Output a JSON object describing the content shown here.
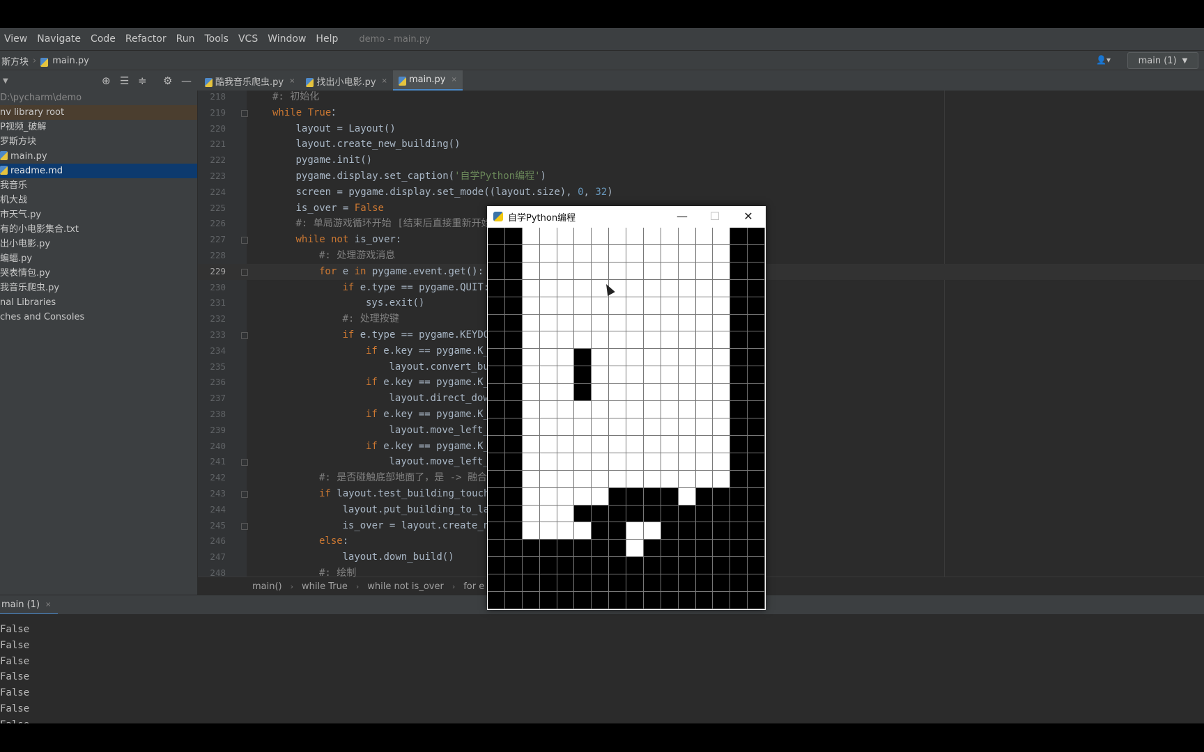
{
  "menu": {
    "items": [
      "View",
      "Navigate",
      "Code",
      "Refactor",
      "Run",
      "Tools",
      "VCS",
      "Window",
      "Help"
    ],
    "window_title": "demo - main.py"
  },
  "nav": {
    "crumb_1": "斯方块",
    "crumb_2": "main.py",
    "run_config": "main (1)"
  },
  "tabs": [
    {
      "label": "酷我音乐爬虫.py",
      "active": false
    },
    {
      "label": "找出小电影.py",
      "active": false
    },
    {
      "label": "main.py",
      "active": true
    }
  ],
  "sidebar": {
    "items": [
      {
        "label": "D:\\pycharm\\demo",
        "style": "gray"
      },
      {
        "label": "nv  library root",
        "style": "hl"
      },
      {
        "label": "P视频_破解",
        "style": ""
      },
      {
        "label": "罗斯方块",
        "style": ""
      },
      {
        "label": "main.py",
        "style": "file"
      },
      {
        "label": "readme.md",
        "style": "sel"
      },
      {
        "label": "我音乐",
        "style": ""
      },
      {
        "label": "机大战",
        "style": ""
      },
      {
        "label": "市天气.py",
        "style": ""
      },
      {
        "label": "有的小电影集合.txt",
        "style": ""
      },
      {
        "label": "出小电影.py",
        "style": ""
      },
      {
        "label": "蝙蝠.py",
        "style": ""
      },
      {
        "label": "哭表情包.py",
        "style": ""
      },
      {
        "label": "我音乐爬虫.py",
        "style": ""
      },
      {
        "label": "nal Libraries",
        "style": ""
      },
      {
        "label": "ches and Consoles",
        "style": ""
      }
    ]
  },
  "editor": {
    "current_line": 229,
    "lines": [
      {
        "n": "218",
        "indent": 0,
        "fold": false,
        "segs": [
          [
            "cm",
            "#: 初始化"
          ]
        ]
      },
      {
        "n": "219",
        "indent": 0,
        "fold": true,
        "segs": [
          [
            "kw",
            "while "
          ],
          [
            "kw",
            "True"
          ],
          [
            "",
            "："
          ]
        ]
      },
      {
        "n": "220",
        "indent": 1,
        "fold": false,
        "segs": [
          [
            "",
            "layout = Layout()"
          ]
        ]
      },
      {
        "n": "221",
        "indent": 1,
        "fold": false,
        "segs": [
          [
            "",
            "layout.create_new_building()"
          ]
        ]
      },
      {
        "n": "222",
        "indent": 1,
        "fold": false,
        "segs": [
          [
            "",
            "pygame.init()"
          ]
        ]
      },
      {
        "n": "223",
        "indent": 1,
        "fold": false,
        "segs": [
          [
            "",
            "pygame.display.set_caption("
          ],
          [
            "str",
            "'自学Python编程'"
          ],
          [
            "",
            ")"
          ]
        ]
      },
      {
        "n": "224",
        "indent": 1,
        "fold": false,
        "segs": [
          [
            "",
            "screen = pygame.display.set_mode((layout.size), "
          ],
          [
            "num",
            "0"
          ],
          [
            "",
            ", "
          ],
          [
            "num",
            "32"
          ],
          [
            "",
            ")"
          ]
        ]
      },
      {
        "n": "225",
        "indent": 1,
        "fold": false,
        "segs": [
          [
            "",
            "is_over = "
          ],
          [
            "kw",
            "False"
          ]
        ]
      },
      {
        "n": "226",
        "indent": 1,
        "fold": false,
        "segs": [
          [
            "cm",
            "#: 单局游戏循环开始 [结束后直接重新开始"
          ]
        ]
      },
      {
        "n": "227",
        "indent": 1,
        "fold": true,
        "segs": [
          [
            "kw",
            "while not "
          ],
          [
            "",
            "is_over:"
          ]
        ]
      },
      {
        "n": "228",
        "indent": 2,
        "fold": false,
        "segs": [
          [
            "cm",
            "#: 处理游戏消息"
          ]
        ]
      },
      {
        "n": "229",
        "indent": 2,
        "fold": true,
        "segs": [
          [
            "kw",
            "for "
          ],
          [
            "",
            "e "
          ],
          [
            "kw",
            "in "
          ],
          [
            "",
            "pygame.event.get():"
          ]
        ]
      },
      {
        "n": "230",
        "indent": 3,
        "fold": false,
        "segs": [
          [
            "kw",
            "if "
          ],
          [
            "",
            "e.type == pygame.QUIT:"
          ]
        ]
      },
      {
        "n": "231",
        "indent": 4,
        "fold": false,
        "segs": [
          [
            "",
            "sys.exit()"
          ]
        ]
      },
      {
        "n": "232",
        "indent": 3,
        "fold": false,
        "segs": [
          [
            "cm",
            "#: 处理按键"
          ]
        ]
      },
      {
        "n": "233",
        "indent": 3,
        "fold": true,
        "segs": [
          [
            "kw",
            "if "
          ],
          [
            "",
            "e.type == pygame.KEYDO"
          ]
        ]
      },
      {
        "n": "234",
        "indent": 4,
        "fold": false,
        "segs": [
          [
            "kw",
            "if "
          ],
          [
            "",
            "e.key == pygame.K_"
          ]
        ]
      },
      {
        "n": "235",
        "indent": 5,
        "fold": false,
        "segs": [
          [
            "",
            "layout.convert_bu"
          ]
        ]
      },
      {
        "n": "236",
        "indent": 4,
        "fold": false,
        "segs": [
          [
            "kw",
            "if "
          ],
          [
            "",
            "e.key == pygame.K_"
          ]
        ]
      },
      {
        "n": "237",
        "indent": 5,
        "fold": false,
        "segs": [
          [
            "",
            "layout.direct_dow"
          ]
        ]
      },
      {
        "n": "238",
        "indent": 4,
        "fold": false,
        "segs": [
          [
            "kw",
            "if "
          ],
          [
            "",
            "e.key == pygame.K_"
          ]
        ]
      },
      {
        "n": "239",
        "indent": 5,
        "fold": false,
        "segs": [
          [
            "",
            "layout.move_left_"
          ]
        ]
      },
      {
        "n": "240",
        "indent": 4,
        "fold": false,
        "segs": [
          [
            "kw",
            "if "
          ],
          [
            "",
            "e.key == pygame.K_"
          ]
        ]
      },
      {
        "n": "241",
        "indent": 5,
        "fold": true,
        "segs": [
          [
            "",
            "layout.move_left_"
          ]
        ]
      },
      {
        "n": "242",
        "indent": 2,
        "fold": false,
        "segs": [
          [
            "cm",
            "#: 是否碰触底部地面了，是 -> 融合背"
          ]
        ]
      },
      {
        "n": "243",
        "indent": 2,
        "fold": true,
        "segs": [
          [
            "kw",
            "if "
          ],
          [
            "",
            "layout.test_building_touch"
          ]
        ]
      },
      {
        "n": "244",
        "indent": 3,
        "fold": false,
        "segs": [
          [
            "",
            "layout.put_building_to_la"
          ]
        ]
      },
      {
        "n": "245",
        "indent": 3,
        "fold": true,
        "segs": [
          [
            "",
            "is_over = layout.create_n"
          ]
        ]
      },
      {
        "n": "246",
        "indent": 2,
        "fold": false,
        "segs": [
          [
            "kw",
            "else"
          ],
          [
            "",
            ":"
          ]
        ]
      },
      {
        "n": "247",
        "indent": 3,
        "fold": false,
        "segs": [
          [
            "",
            "layout.down_build()"
          ]
        ]
      },
      {
        "n": "248",
        "indent": 2,
        "fold": false,
        "segs": [
          [
            "cm",
            "#: 绘制"
          ]
        ]
      }
    ]
  },
  "breadcrumbs": [
    "main()",
    "while True",
    "while not is_over",
    "for e in py"
  ],
  "run": {
    "tab_label": "main (1)",
    "output": [
      "False",
      "False",
      "False",
      "False",
      "False",
      "False",
      "False"
    ]
  },
  "game_window": {
    "title": "自学Python编程",
    "minimize": "—",
    "maximize": "☐",
    "close": "✕",
    "cols": 16,
    "rows": 22,
    "grid": [
      "BBWWWWWWWWWWWWBB",
      "BBWWWWWWWWWWWWBB",
      "BBWWWWWWWWWWWWBB",
      "BBWWWWWWWWWWWWBB",
      "BBWWWWWWWWWWWWBB",
      "BBWWWWWWWWWWWWBB",
      "BBWWWWWWWWWWWWBB",
      "BBWWWBWWWWWWWWBB",
      "BBWWWBWWWWWWWWBB",
      "BBWWWBWWWWWWWWBB",
      "BBWWWWWWWWWWWWBB",
      "BBWWWWWWWWWWWWBB",
      "BBWWWWWWWWWWWWBB",
      "BBWWWWWWWWWWWWBB",
      "BBWWWWWWWWWWWWBB",
      "BBWWWWWBBBBWBBBB",
      "BBWWWBBBBBBBBBBB",
      "BBWWWWBBWWBBBBBB",
      "BBBBBBBBWBBBBBBB",
      "BBBBBBBBBBBBBBBB",
      "BBBBBBBBBBBBBBBB",
      "BBBBBBBBBBBBBBBB"
    ]
  }
}
